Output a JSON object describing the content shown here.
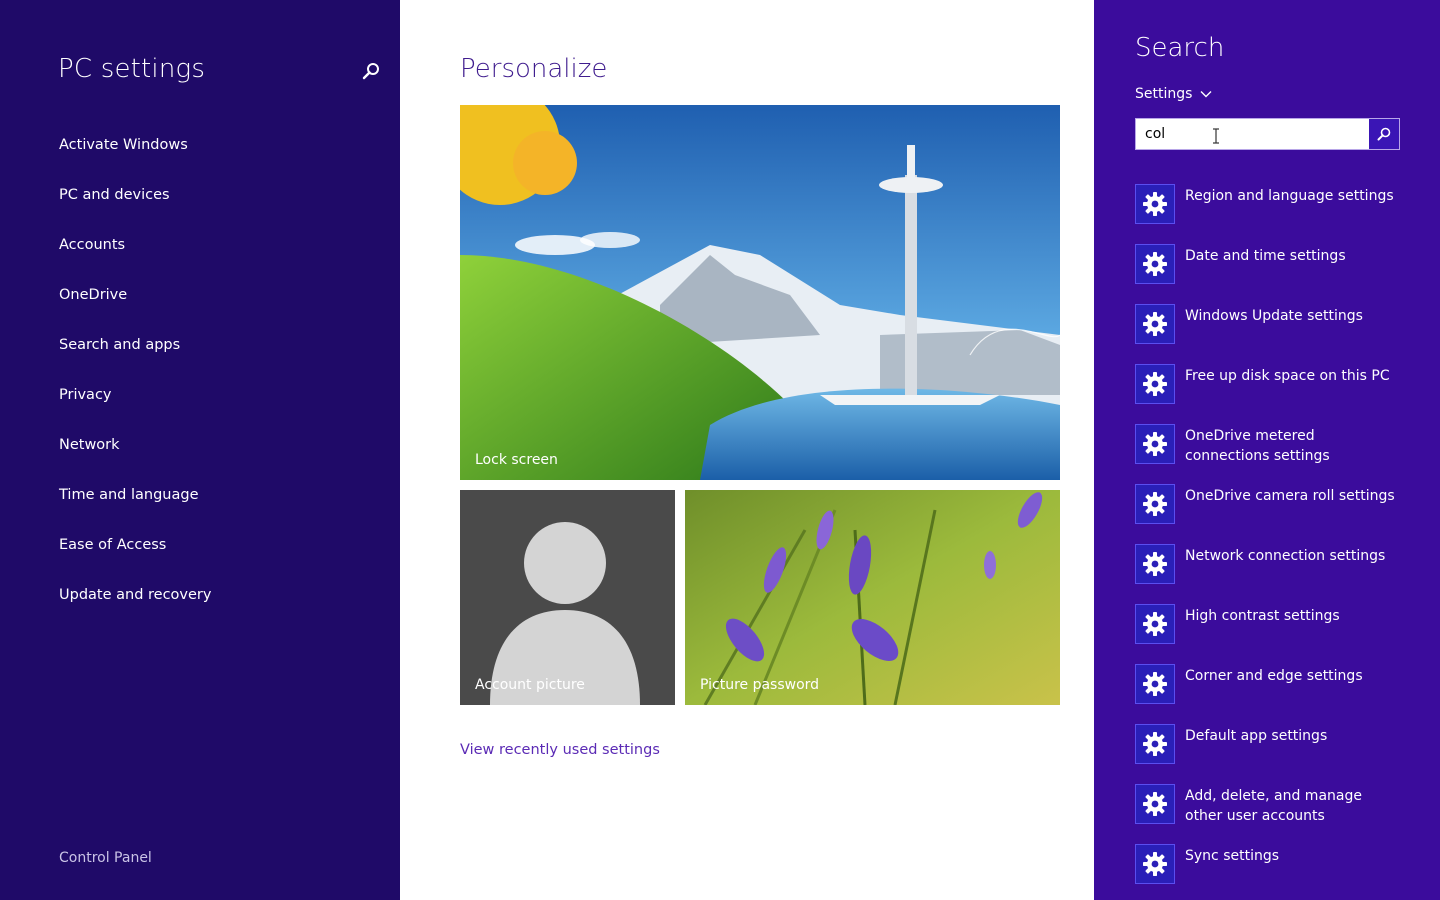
{
  "left": {
    "title": "PC settings",
    "nav": [
      "Activate Windows",
      "PC and devices",
      "Accounts",
      "OneDrive",
      "Search and apps",
      "Privacy",
      "Network",
      "Time and language",
      "Ease of Access",
      "Update and recovery"
    ],
    "footer": "Control Panel"
  },
  "main": {
    "heading": "Personalize",
    "tiles": {
      "lock": "Lock screen",
      "account": "Account picture",
      "picture": "Picture password"
    },
    "recent_link": "View recently used settings"
  },
  "search": {
    "title": "Search",
    "scope": "Settings",
    "query": "col",
    "results": [
      "Region and language settings",
      "Date and time settings",
      "Windows Update settings",
      "Free up disk space on this PC",
      "OneDrive metered connections settings",
      "OneDrive camera roll settings",
      "Network connection settings",
      "High contrast settings",
      "Corner and edge settings",
      "Default app settings",
      "Add, delete, and manage other user accounts",
      "Sync settings"
    ]
  },
  "colors": {
    "left_bg": "#1f0a68",
    "search_bg": "#3b0c9c",
    "accent": "#5b2bb5",
    "result_icon_bg": "#2a1fb8"
  },
  "icons": {
    "nav_search": "search-icon",
    "search_go": "search-icon",
    "scope_toggle": "chevron-down-icon",
    "result_icon": "gear-icon",
    "account_placeholder": "person-silhouette-icon"
  }
}
